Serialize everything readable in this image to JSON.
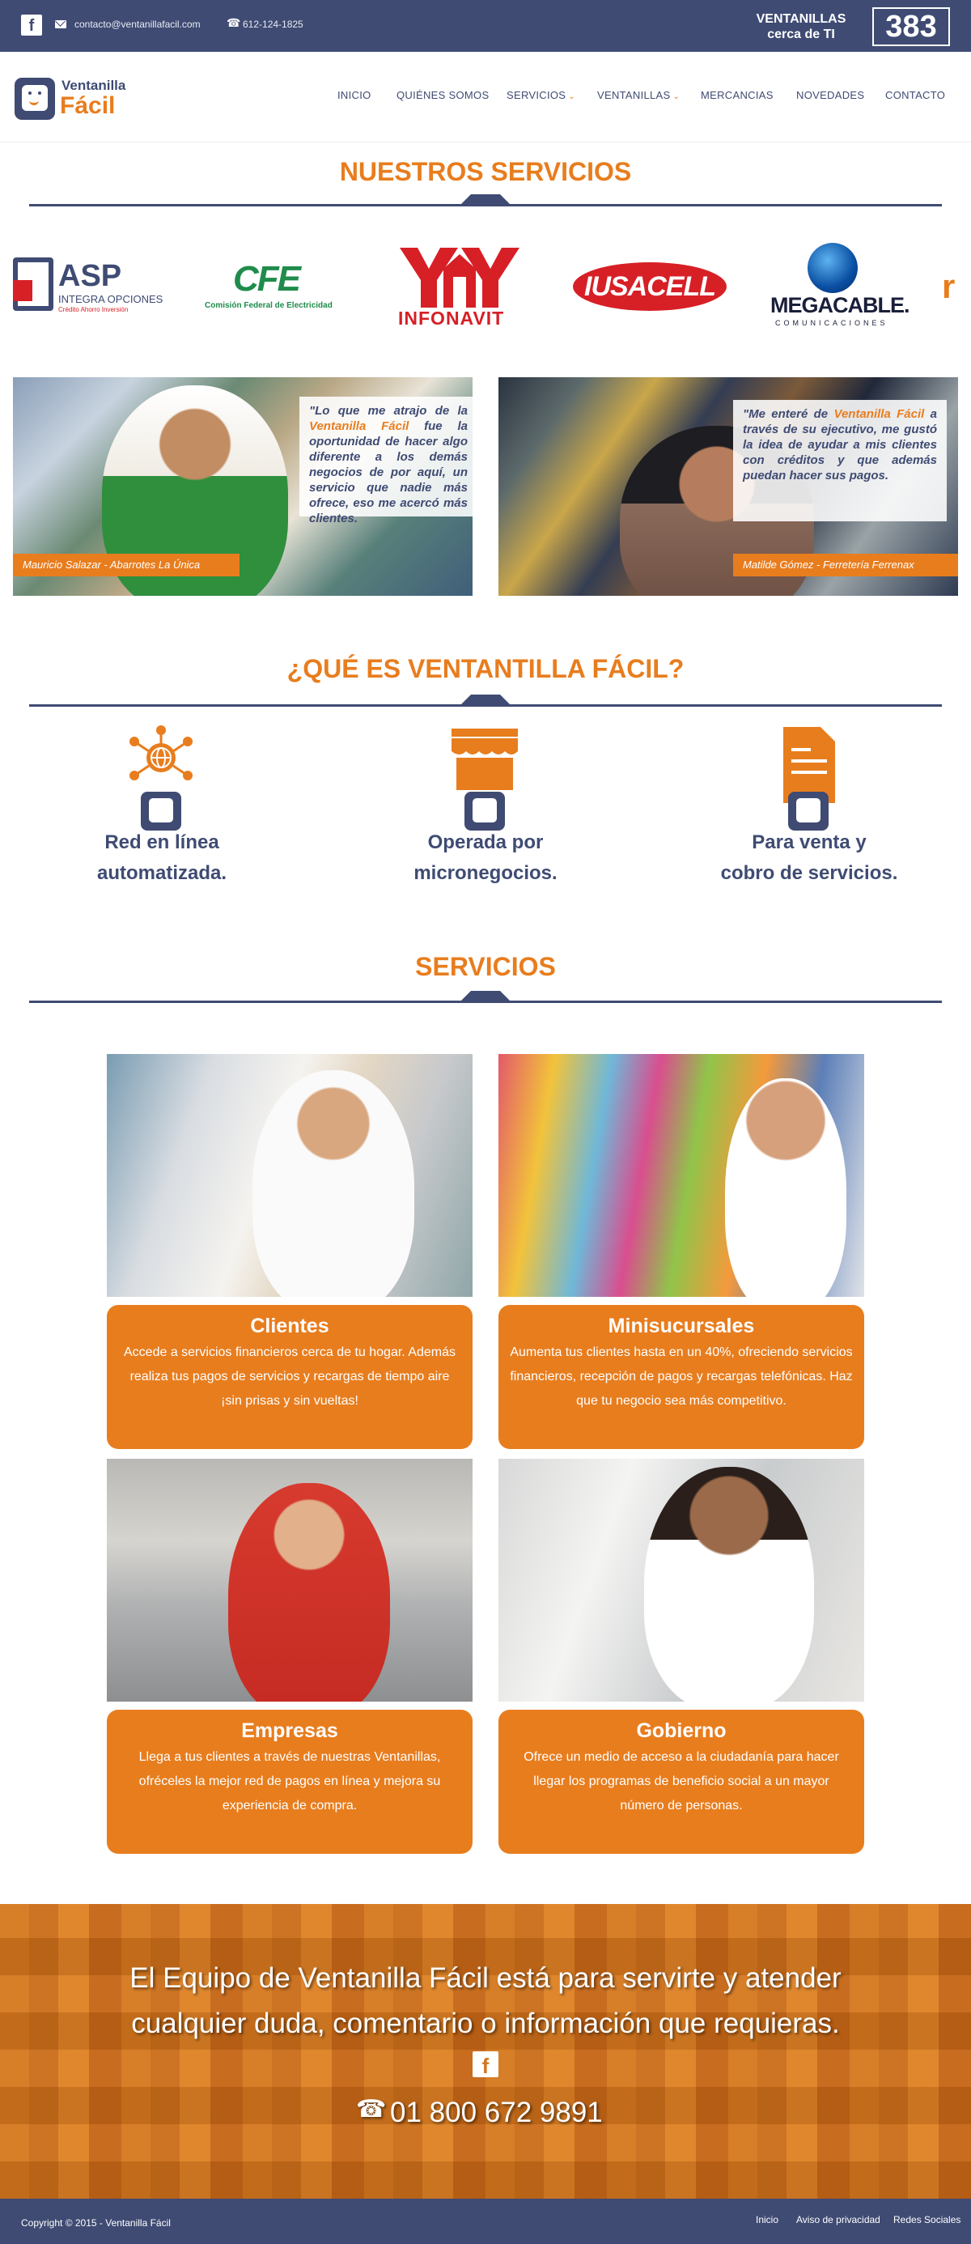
{
  "topbar": {
    "facebook_glyph": "f",
    "email": "contacto@ventanillafacil.com",
    "phone": "612-124-1825",
    "ventanillas_line1": "VENTANILLAS",
    "ventanillas_line2": "cerca de TI",
    "ventanillas_count": "383"
  },
  "header": {
    "logo_line1": "Ventanilla",
    "logo_line2": "Fácil",
    "nav": [
      {
        "label": "INICIO"
      },
      {
        "label": "QUIÉNES SOMOS"
      },
      {
        "label": "SERVICIOS",
        "has_dropdown": true
      },
      {
        "label": "VENTANILLAS",
        "has_dropdown": true
      },
      {
        "label": "MERCANCIAS"
      },
      {
        "label": "NOVEDADES"
      },
      {
        "label": "CONTACTO"
      }
    ]
  },
  "nuestros_servicios": {
    "title": "NUESTROS SERVICIOS",
    "logos": {
      "asp_name": "ASP",
      "asp_sub": "INTEGRA OPCIONES",
      "asp_tagline": "Crédito Ahorro Inversión",
      "cfe_name": "CFE",
      "cfe_sub": "Comisión Federal de Electricidad",
      "infonavit": "INFONAVIT",
      "iusacell": "IUSACELL",
      "megacable": "MEGACABLE.",
      "megacable_sub": "COMUNICACIONES"
    }
  },
  "testimonials": [
    {
      "quote_pre": "\"Lo que me atrajo de la ",
      "quote_hl": "Ventanilla Fácil",
      "quote_post": " fue la oportunidad de hacer algo diferente a los demás negocios de por aquí, un servicio que nadie más ofrece, eso me acercó más clientes.",
      "caption": "Mauricio Salazar - Abarrotes La Única"
    },
    {
      "quote_pre": "\"Me enteré de ",
      "quote_hl": "Ventanilla Fácil",
      "quote_post": " a través de su ejecutivo, me gustó la idea de ayudar a mis clientes con créditos y que además puedan hacer sus pagos.",
      "caption": "Matilde Gómez - Ferretería Ferrenax"
    }
  ],
  "que_es": {
    "title": "¿QUÉ ES VENTANTILLA FÁCIL?",
    "features": [
      {
        "line1": "Red en línea",
        "line2": "automatizada.",
        "icon": "network-icon"
      },
      {
        "line1": "Operada por",
        "line2": "micronegocios.",
        "icon": "store-icon"
      },
      {
        "line1": "Para venta y",
        "line2": "cobro de servicios.",
        "icon": "invoice-icon"
      }
    ]
  },
  "servicios": {
    "title": "SERVICIOS",
    "cards": [
      {
        "title": "Clientes",
        "text": "Accede a servicios financieros cerca de tu hogar. Además realiza tus pagos de servicios y recargas de tiempo aire ¡sin prisas y sin vueltas!"
      },
      {
        "title": "Minisucursales",
        "text": "Aumenta tus clientes hasta en un 40%, ofreciendo servicios financieros, recepción de pagos y recargas telefónicas. Haz que tu negocio sea más competitivo."
      },
      {
        "title": "Empresas",
        "text": "Llega a tus clientes a través de nuestras Ventanillas, ofréceles la mejor red de pagos en línea y mejora su experiencia de compra."
      },
      {
        "title": "Gobierno",
        "text": "Ofrece un medio de acceso a la ciudadanía para hacer llegar los programas de beneficio social a un mayor número de personas."
      }
    ]
  },
  "contact_band": {
    "line1": "El Equipo de Ventanilla Fácil está para servirte y atender",
    "line2": "cualquier duda, comentario o información que requieras.",
    "facebook_glyph": "f",
    "phone": "01 800 672 9891"
  },
  "footer": {
    "copyright": "Copyright © 2015 - Ventanilla Fácil",
    "links": [
      {
        "label": "Inicio"
      },
      {
        "label": "Aviso de privacidad"
      },
      {
        "label": "Redes Sociales"
      }
    ]
  },
  "colors": {
    "navy": "#3f4b73",
    "orange": "#e87d1e"
  }
}
